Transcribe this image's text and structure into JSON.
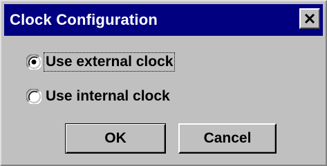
{
  "window": {
    "title": "Clock Configuration",
    "close_icon": "close-icon"
  },
  "options": [
    {
      "label": "Use external clock",
      "selected": true,
      "focused": true
    },
    {
      "label": "Use internal clock",
      "selected": false,
      "focused": false
    }
  ],
  "buttons": {
    "ok_label": "OK",
    "cancel_label": "Cancel"
  },
  "colors": {
    "titlebar": "#000080",
    "title_text": "#ffffff",
    "face": "#c0c0c0"
  }
}
